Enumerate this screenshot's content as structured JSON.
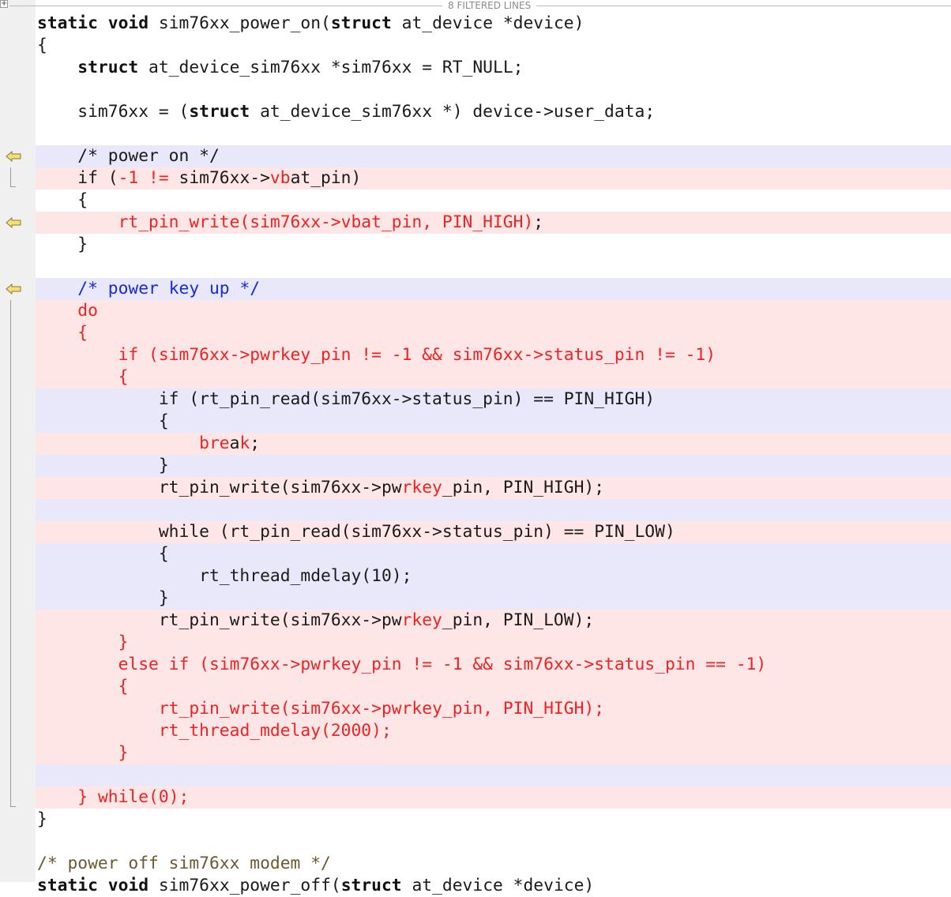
{
  "filter_bar": {
    "label": "8 FILTERED LINES",
    "toggle": "+"
  },
  "code_lines": [
    {
      "bg": "",
      "segs": [
        {
          "t": "static",
          "c": "k"
        },
        {
          "t": " "
        },
        {
          "t": "void",
          "c": "k"
        },
        {
          "t": " sim76xx_power_on("
        },
        {
          "t": "struct",
          "c": "k"
        },
        {
          "t": " at_device *device)"
        }
      ]
    },
    {
      "bg": "",
      "segs": [
        {
          "t": "{"
        }
      ]
    },
    {
      "bg": "",
      "segs": [
        {
          "t": "    "
        },
        {
          "t": "struct",
          "c": "k"
        },
        {
          "t": " at_device_sim76xx *sim76xx = RT_NULL;"
        }
      ]
    },
    {
      "bg": "",
      "segs": [
        {
          "t": ""
        }
      ]
    },
    {
      "bg": "",
      "segs": [
        {
          "t": "    sim76xx = ("
        },
        {
          "t": "struct",
          "c": "k"
        },
        {
          "t": " at_device_sim76xx *) device->user_data;"
        }
      ]
    },
    {
      "bg": "",
      "segs": [
        {
          "t": ""
        }
      ]
    },
    {
      "bg": "chg",
      "segs": [
        {
          "t": "    /* power on */"
        }
      ]
    },
    {
      "bg": "del",
      "segs": [
        {
          "t": "    if ("
        },
        {
          "t": "-1 !=",
          "c": "r"
        },
        {
          "t": " sim76xx->"
        },
        {
          "t": "vb",
          "c": "r"
        },
        {
          "t": "at_pin)"
        }
      ]
    },
    {
      "bg": "",
      "segs": [
        {
          "t": "    {"
        }
      ]
    },
    {
      "bg": "del",
      "segs": [
        {
          "t": "        "
        },
        {
          "t": "rt_pin_write(sim76xx->vbat_pin, PIN_HIGH)",
          "c": "r"
        },
        {
          "t": ";"
        }
      ]
    },
    {
      "bg": "",
      "segs": [
        {
          "t": "    }"
        }
      ]
    },
    {
      "bg": "",
      "segs": [
        {
          "t": ""
        }
      ]
    },
    {
      "bg": "chg",
      "segs": [
        {
          "t": "    "
        },
        {
          "t": "/* power key up */",
          "c": "b"
        }
      ]
    },
    {
      "bg": "del",
      "segs": [
        {
          "t": "    "
        },
        {
          "t": "do",
          "c": "r"
        }
      ]
    },
    {
      "bg": "del",
      "segs": [
        {
          "t": "    "
        },
        {
          "t": "{",
          "c": "r"
        }
      ]
    },
    {
      "bg": "del",
      "segs": [
        {
          "t": "        "
        },
        {
          "t": "if (sim76xx->pwrkey_pin != -1 && sim76xx->status_pin != -1)",
          "c": "r"
        }
      ]
    },
    {
      "bg": "del",
      "segs": [
        {
          "t": "        "
        },
        {
          "t": "{",
          "c": "r"
        }
      ]
    },
    {
      "bg": "chg",
      "segs": [
        {
          "t": "            if (rt_pin_read(sim76xx->status_pin) == PIN_HIGH)"
        }
      ]
    },
    {
      "bg": "chg",
      "segs": [
        {
          "t": "            {"
        }
      ]
    },
    {
      "bg": "del",
      "segs": [
        {
          "t": "                "
        },
        {
          "t": "bre",
          "c": "r"
        },
        {
          "t": "a"
        },
        {
          "t": "k",
          "c": "r"
        },
        {
          "t": ";"
        }
      ]
    },
    {
      "bg": "chg",
      "segs": [
        {
          "t": "            }"
        }
      ]
    },
    {
      "bg": "del",
      "segs": [
        {
          "t": "            rt_pin_write(sim76xx->pw"
        },
        {
          "t": "rkey",
          "c": "r"
        },
        {
          "t": "_pin, PIN_HIGH);"
        }
      ]
    },
    {
      "bg": "chg",
      "segs": [
        {
          "t": ""
        }
      ]
    },
    {
      "bg": "del",
      "segs": [
        {
          "t": "            while (rt_pin_read(sim76xx->status_pin) == PIN_LOW)"
        }
      ]
    },
    {
      "bg": "chg",
      "segs": [
        {
          "t": "            {"
        }
      ]
    },
    {
      "bg": "chg",
      "segs": [
        {
          "t": "                rt_thread_mdelay(10);"
        }
      ]
    },
    {
      "bg": "chg",
      "segs": [
        {
          "t": "            }"
        }
      ]
    },
    {
      "bg": "del",
      "segs": [
        {
          "t": "            rt_pin_write(sim76xx->pw"
        },
        {
          "t": "rkey",
          "c": "r"
        },
        {
          "t": "_pin, PIN_LOW);"
        }
      ]
    },
    {
      "bg": "del",
      "segs": [
        {
          "t": "        "
        },
        {
          "t": "}",
          "c": "r"
        }
      ]
    },
    {
      "bg": "del",
      "segs": [
        {
          "t": "        "
        },
        {
          "t": "else if (sim76xx->pwrkey_pin != -1 && sim76xx->status_pin == -1)",
          "c": "r"
        }
      ]
    },
    {
      "bg": "del",
      "segs": [
        {
          "t": "        "
        },
        {
          "t": "{",
          "c": "r"
        }
      ]
    },
    {
      "bg": "del",
      "segs": [
        {
          "t": "            "
        },
        {
          "t": "rt_pin_write(sim76xx->pwrkey_pin, PIN_HIGH);",
          "c": "r"
        }
      ]
    },
    {
      "bg": "del",
      "segs": [
        {
          "t": "            "
        },
        {
          "t": "rt_thread_mdelay(2000);",
          "c": "r"
        }
      ]
    },
    {
      "bg": "del",
      "segs": [
        {
          "t": "        "
        },
        {
          "t": "}",
          "c": "r"
        }
      ]
    },
    {
      "bg": "chg",
      "segs": [
        {
          "t": ""
        }
      ]
    },
    {
      "bg": "del",
      "segs": [
        {
          "t": "    "
        },
        {
          "t": "} while(0);",
          "c": "r"
        }
      ]
    },
    {
      "bg": "",
      "segs": [
        {
          "t": "}"
        }
      ]
    },
    {
      "bg": "",
      "segs": [
        {
          "t": ""
        }
      ]
    },
    {
      "bg": "",
      "segs": [
        {
          "t": "/* power off sim76xx modem */",
          "c": "c"
        }
      ]
    },
    {
      "bg": "",
      "segs": [
        {
          "t": "static",
          "c": "k"
        },
        {
          "t": " "
        },
        {
          "t": "void",
          "c": "k"
        },
        {
          "t": " sim76xx_power_off("
        },
        {
          "t": "struct",
          "c": "k"
        },
        {
          "t": " at_device *device)"
        }
      ]
    }
  ],
  "gutter_markers": [
    {
      "line": 6,
      "icon": "arrow-left-icon"
    },
    {
      "line": 9,
      "icon": "arrow-left-icon"
    },
    {
      "line": 12,
      "icon": "arrow-left-icon"
    }
  ],
  "colors": {
    "deleted_bg": "#ffe6e6",
    "changed_bg": "#e8e8fa",
    "deleted_text": "#ee2222",
    "comment_blue": "#1a2ad8",
    "comment_brown": "#6b5a2f",
    "marker_fill": "#f3e07a"
  }
}
